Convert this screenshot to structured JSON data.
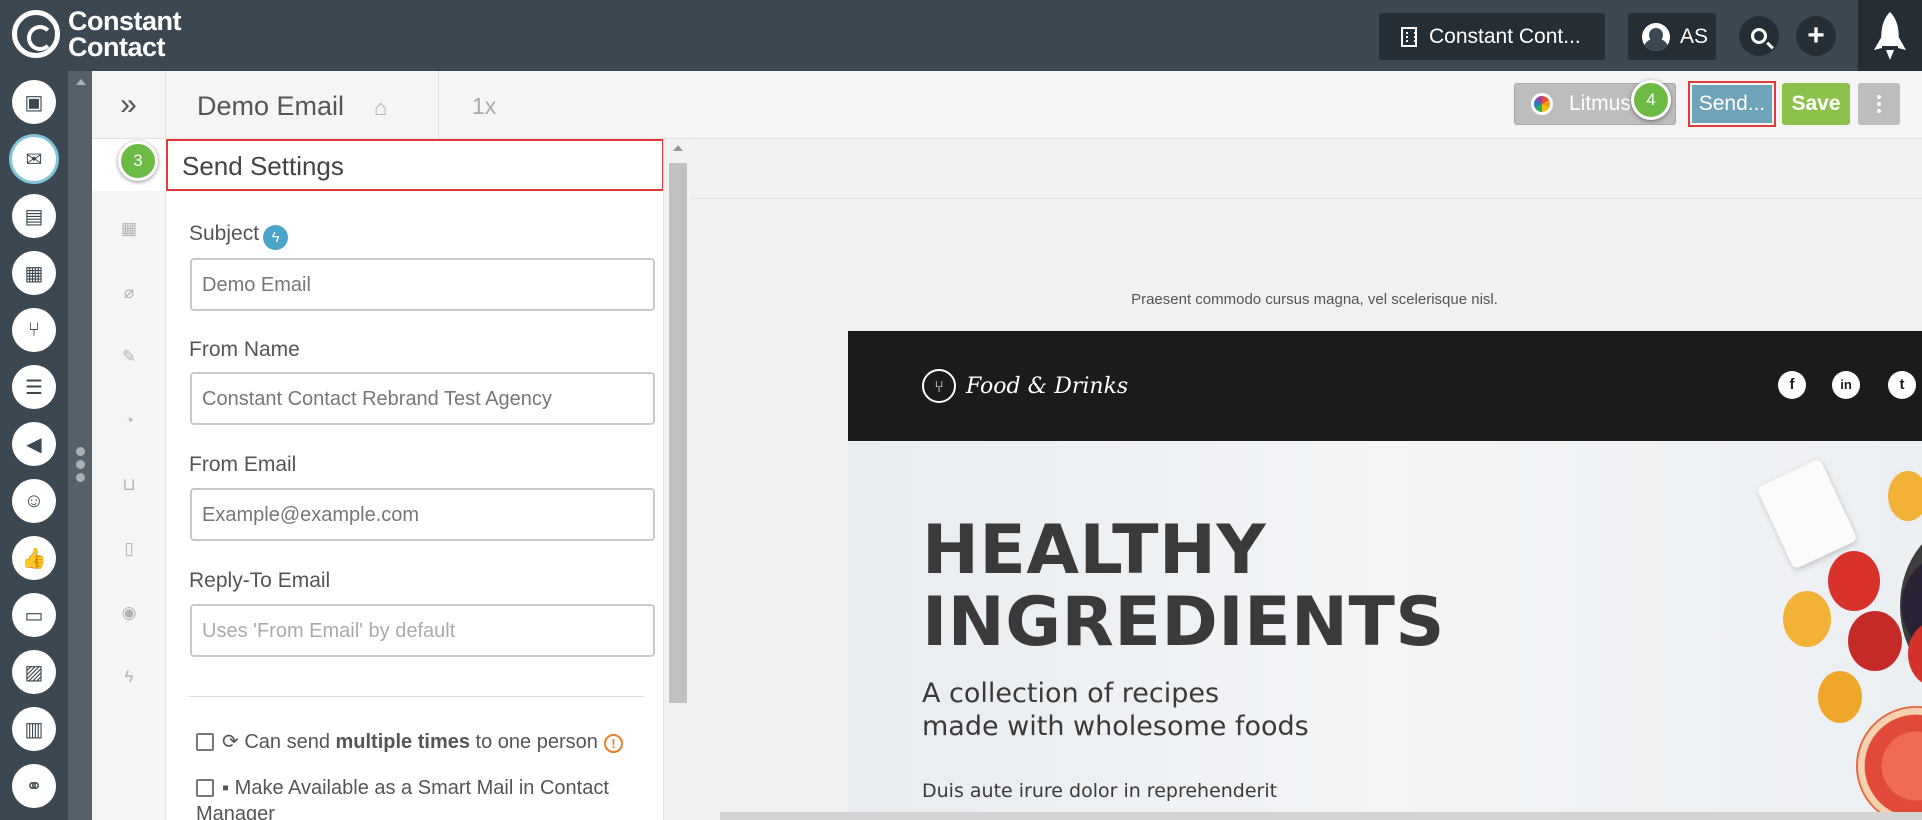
{
  "topbar": {
    "logo_line1": "Constant",
    "logo_line2": "Contact",
    "account_label": "Constant Cont...",
    "user_initials": "AS"
  },
  "editor": {
    "doc_title": "Demo Email",
    "zoom": "1x",
    "litmus_label": "Litmus",
    "send_label": "Send...",
    "save_label": "Save"
  },
  "badges": {
    "step3": "3",
    "step4": "4"
  },
  "panel": {
    "title": "Send Settings",
    "subject_label": "Subject",
    "subject_value": "Demo Email",
    "from_name_label": "From Name",
    "from_name_value": "Constant Contact Rebrand Test Agency",
    "from_email_label": "From Email",
    "from_email_value": "Example@example.com",
    "reply_to_label": "Reply-To Email",
    "reply_to_placeholder": "Uses 'From Email' by default",
    "opt1_pre": "Can send ",
    "opt1_bold": "multiple times",
    "opt1_post": " to one person",
    "opt2": "Make Available as a Smart Mail in Contact Manager"
  },
  "preview": {
    "preheader": "Praesent commodo cursus magna, vel scelerisque nisl.",
    "brand": "Food & Drinks",
    "headline_line1": "HEALTHY",
    "headline_line2": "INGREDIENTS",
    "subhead_line1": "A collection of recipes",
    "subhead_line2": "made with wholesome foods",
    "body": "Duis aute irure dolor in reprehenderit"
  },
  "icons": {
    "rail": [
      "contacts-icon",
      "email-icon",
      "forms-icon",
      "map-icon",
      "workflow-icon",
      "list-icon",
      "megaphone-icon",
      "survey-icon",
      "like-icon",
      "video-icon",
      "image-library-icon",
      "calendar-icon",
      "handshake-icon"
    ],
    "tools": [
      "layout-icon",
      "attachment-icon",
      "brush-icon",
      "rss-icon",
      "cart-icon",
      "document-icon",
      "preview-eye-icon",
      "bolt-icon"
    ]
  },
  "colors": {
    "topbar": "#3b4852",
    "send_button": "#6fa3b8",
    "save_button": "#8cc14c",
    "highlight_border": "#e23b3b",
    "step_badge": "#6dbb45"
  }
}
